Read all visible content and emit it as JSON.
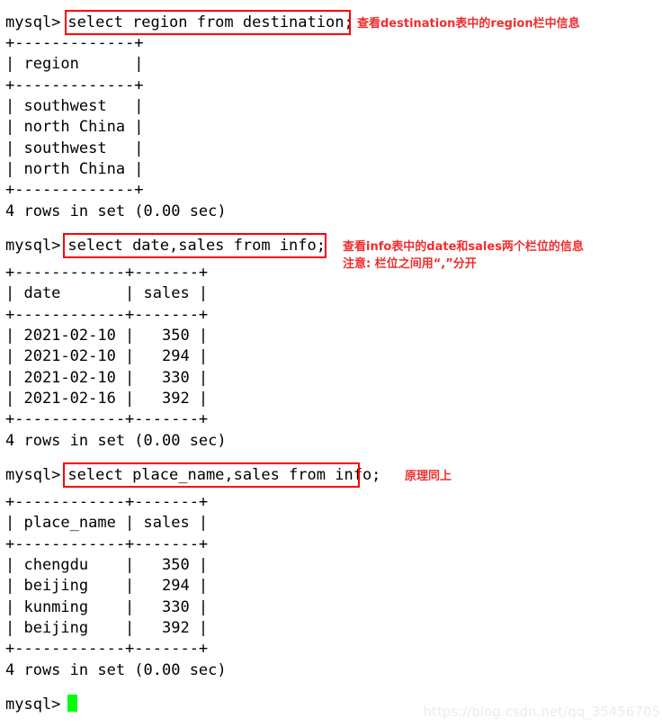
{
  "terminal": {
    "prompt": "mysql>",
    "background_color": "#ffffff",
    "text_color": "#000000",
    "cursor_color": "#00ff00",
    "annotation_color": "#ef2d2d",
    "highlight_box_color": "#ff0000"
  },
  "blocks": [
    {
      "id": "block-1",
      "prompt": "mysql>",
      "command": "select region from destination;",
      "annotation": [
        "查看destination表中的region栏中信息"
      ],
      "separator_top": "+-------------+",
      "header_row": "| region      |",
      "separator_mid": "+-------------+",
      "rows": [
        "| southwest   |",
        "| north China |",
        "| southwest   |",
        "| north China |"
      ],
      "separator_bottom": "+-------------+",
      "status": "4 rows in set (0.00 sec)"
    },
    {
      "id": "block-2",
      "prompt": "mysql>",
      "command": "select date,sales from info;",
      "annotation": [
        "查看info表中的date和sales两个栏位的信息",
        "注意: 栏位之间用“,”分开"
      ],
      "separator_top": "+------------+-------+",
      "header_row": "| date       | sales |",
      "separator_mid": "+------------+-------+",
      "rows": [
        "| 2021-02-10 |   350 |",
        "| 2021-02-10 |   294 |",
        "| 2021-02-10 |   330 |",
        "| 2021-02-16 |   392 |"
      ],
      "separator_bottom": "+------------+-------+",
      "status": "4 rows in set (0.00 sec)"
    },
    {
      "id": "block-3",
      "prompt": "mysql>",
      "command": "select place_name,sales from info;",
      "annotation": [
        "原理同上"
      ],
      "separator_top": "+------------+-------+",
      "header_row": "| place_name | sales |",
      "separator_mid": "+------------+-------+",
      "rows": [
        "| chengdu    |   350 |",
        "| beijing    |   294 |",
        "| kunming    |   330 |",
        "| beijing    |   392 |"
      ],
      "separator_bottom": "+------------+-------+",
      "status": "4 rows in set (0.00 sec)"
    }
  ],
  "final_prompt": "mysql>",
  "watermark": "https://blog.csdn.net/qq_35456705"
}
